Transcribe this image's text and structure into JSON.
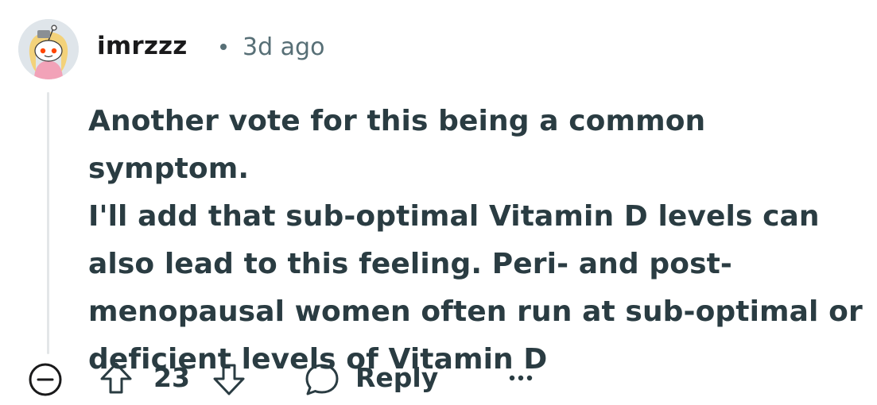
{
  "comment": {
    "username": "imrzzz",
    "separator": "•",
    "timestamp": "3d ago",
    "body": [
      "Another vote for this being a common symptom.",
      "I'll add that sub-optimal Vitamin D levels can",
      "also lead to this feeling. Peri- and post-",
      "menopausal women often run at sub-optimal or",
      "deficient levels of Vitamin D"
    ]
  },
  "actions": {
    "score": "23",
    "reply_label": "Reply",
    "collapse_icon": "collapse-minus-icon",
    "upvote_icon": "upvote-arrow-icon",
    "downvote_icon": "downvote-arrow-icon",
    "reply_icon": "chat-bubble-icon",
    "more_icon": "ellipsis-icon"
  },
  "colors": {
    "text": "#2a3c42",
    "muted": "#576f76",
    "thread_line": "#e3e6e8",
    "avatar_bg": "#dfe5ea"
  }
}
